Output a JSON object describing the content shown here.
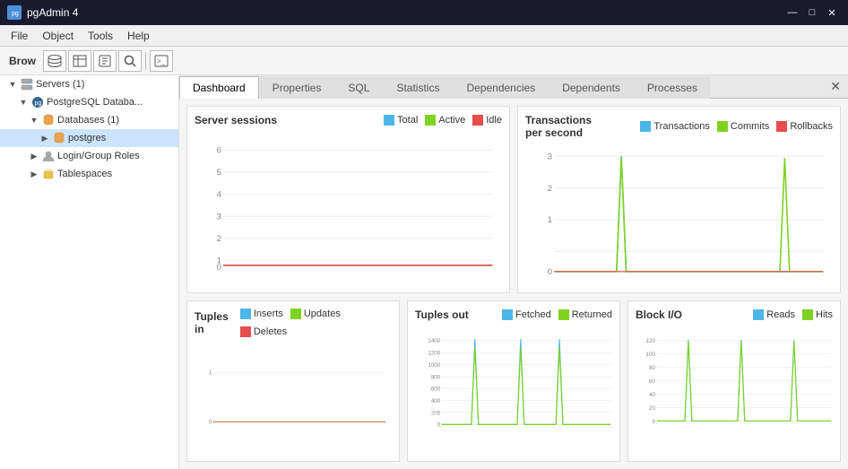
{
  "titleBar": {
    "appName": "pgAdmin 4",
    "controls": [
      "—",
      "□",
      "✕"
    ]
  },
  "menuBar": {
    "items": [
      "File",
      "Object",
      "Tools",
      "Help"
    ]
  },
  "toolbar": {
    "label": "Brow",
    "buttons": [
      "🗄",
      "☰",
      "📋",
      "🔍",
      "⌨"
    ]
  },
  "sidebar": {
    "items": [
      {
        "level": 0,
        "label": "Servers (1)",
        "arrow": "▼",
        "icon": "🖥",
        "selected": false
      },
      {
        "level": 1,
        "label": "PostgreSQL Databa...",
        "arrow": "▼",
        "icon": "🐘",
        "selected": false
      },
      {
        "level": 2,
        "label": "Databases (1)",
        "arrow": "▼",
        "icon": "🗄",
        "selected": false
      },
      {
        "level": 3,
        "label": "postgres",
        "arrow": "▶",
        "icon": "🗄",
        "selected": false
      },
      {
        "level": 2,
        "label": "Login/Group Roles",
        "arrow": "▶",
        "icon": "👤",
        "selected": false
      },
      {
        "level": 2,
        "label": "Tablespaces",
        "arrow": "▶",
        "icon": "📁",
        "selected": false
      }
    ]
  },
  "tabs": {
    "items": [
      "Dashboard",
      "Properties",
      "SQL",
      "Statistics",
      "Dependencies",
      "Dependents",
      "Processes"
    ],
    "active": 0
  },
  "charts": {
    "serverSessions": {
      "title": "Server sessions",
      "legend": [
        {
          "label": "Total",
          "color": "#4db6e8"
        },
        {
          "label": "Active",
          "color": "#7ed321"
        },
        {
          "label": "Idle",
          "color": "#e84d4d"
        }
      ],
      "yLabels": [
        "6",
        "5",
        "4",
        "3",
        "2",
        "1",
        "0"
      ]
    },
    "transactions": {
      "title": "Transactions per second",
      "legend": [
        {
          "label": "Transactions",
          "color": "#4db6e8"
        },
        {
          "label": "Commits",
          "color": "#7ed321"
        },
        {
          "label": "Rollbacks",
          "color": "#e84d4d"
        }
      ],
      "yLabels": [
        "3",
        "2",
        "1",
        "0"
      ]
    },
    "tuplesIn": {
      "title": "Tuples in",
      "legend": [
        {
          "label": "Inserts",
          "color": "#4db6e8"
        },
        {
          "label": "Updates",
          "color": "#7ed321"
        },
        {
          "label": "Deletes",
          "color": "#e84d4d"
        }
      ],
      "yLabels": [
        "1",
        "0"
      ]
    },
    "tuplesOut": {
      "title": "Tuples out",
      "legend": [
        {
          "label": "Fetched",
          "color": "#4db6e8"
        },
        {
          "label": "Returned",
          "color": "#7ed321"
        }
      ],
      "yLabels": [
        "1400",
        "1200",
        "1000",
        "800",
        "600",
        "400",
        "200",
        "0"
      ]
    },
    "blockIO": {
      "title": "Block I/O",
      "legend": [
        {
          "label": "Reads",
          "color": "#4db6e8"
        },
        {
          "label": "Hits",
          "color": "#7ed321"
        }
      ],
      "yLabels": [
        "120",
        "100",
        "80",
        "60",
        "40",
        "20",
        "0"
      ]
    }
  },
  "panelCloseLabel": "✕"
}
